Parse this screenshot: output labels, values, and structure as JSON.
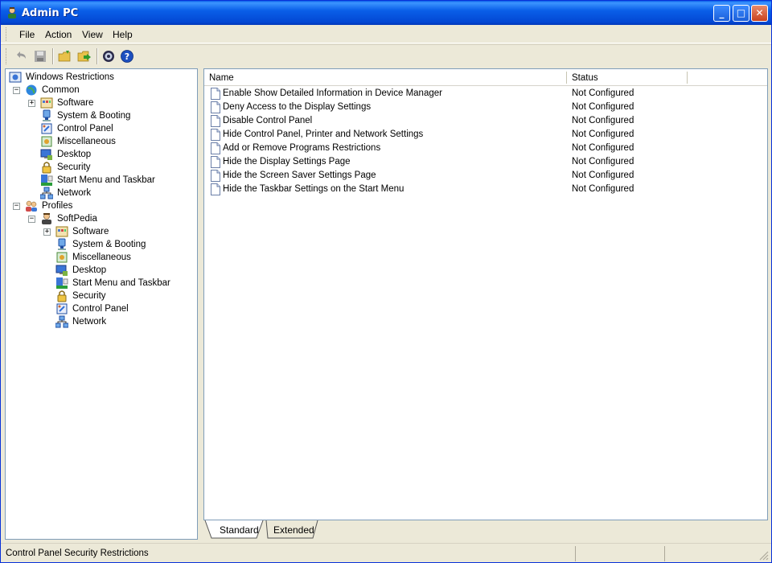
{
  "window": {
    "title": "Admin PC",
    "controls": {
      "minimize": "_",
      "maximize": "□",
      "close": "✕"
    }
  },
  "menu": [
    "File",
    "Action",
    "View",
    "Help"
  ],
  "toolbar": {
    "buttons": [
      "undo-icon",
      "save-icon",
      "open-folder-icon",
      "export-icon",
      "settings-icon",
      "help-icon"
    ]
  },
  "tree": {
    "root": "Windows Restrictions",
    "common": {
      "label": "Common",
      "children": [
        "Software",
        "System & Booting",
        "Control Panel",
        "Miscellaneous",
        "Desktop",
        "Security",
        "Start Menu and Taskbar",
        "Network"
      ]
    },
    "profiles": {
      "label": "Profiles",
      "profile": "SoftPedia",
      "children": [
        "Software",
        "System & Booting",
        "Miscellaneous",
        "Desktop",
        "Start Menu and Taskbar",
        "Security",
        "Control Panel",
        "Network"
      ]
    }
  },
  "list": {
    "columns": [
      "Name",
      "Status"
    ],
    "rows": [
      {
        "name": "Enable Show Detailed Information in Device Manager",
        "status": "Not Configured"
      },
      {
        "name": "Deny Access to the Display Settings",
        "status": "Not Configured"
      },
      {
        "name": "Disable Control Panel",
        "status": "Not Configured"
      },
      {
        "name": "Hide Control Panel, Printer and Network Settings",
        "status": "Not Configured"
      },
      {
        "name": "Add or Remove Programs Restrictions",
        "status": "Not Configured"
      },
      {
        "name": "Hide the Display Settings Page",
        "status": "Not Configured"
      },
      {
        "name": "Hide the Screen Saver Settings Page",
        "status": "Not Configured"
      },
      {
        "name": "Hide the Taskbar Settings on the Start Menu",
        "status": "Not Configured"
      }
    ]
  },
  "tabs": [
    "Standard",
    "Extended"
  ],
  "statusbar": {
    "text": "Control Panel Security Restrictions"
  },
  "colors": {
    "titlebar": "#0A5FE8",
    "chrome": "#ECE9D8",
    "pane_border": "#7F9DB9",
    "close_button": "#C8421E"
  }
}
